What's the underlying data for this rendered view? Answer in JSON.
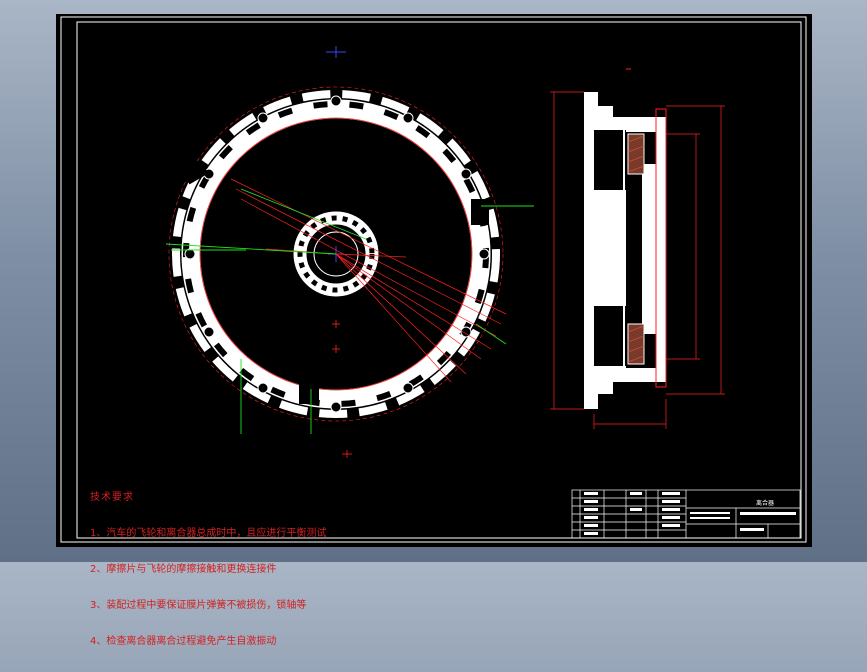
{
  "drawing": {
    "technical_notes": {
      "title": "技术要求",
      "items": [
        "1、汽车的飞轮和离合器总成时中，且应进行平衡测试",
        "2、摩擦片与飞轮的摩擦接触和更换连接件",
        "3、装配过程中要保证膜片弹簧不被损伤，锁轴等",
        "4、检查离合器离合过程避免产生自激振动"
      ]
    },
    "title_block": {
      "name_cell": "离合器",
      "drawing_no": "",
      "scale": ""
    },
    "colors": {
      "background": "#000000",
      "border": "#ffffff",
      "part": "#ffffff",
      "dimension": "#ff2020",
      "leader": "#20e020",
      "center_mark": "#4040ff",
      "text_notes": "#d42020"
    }
  }
}
